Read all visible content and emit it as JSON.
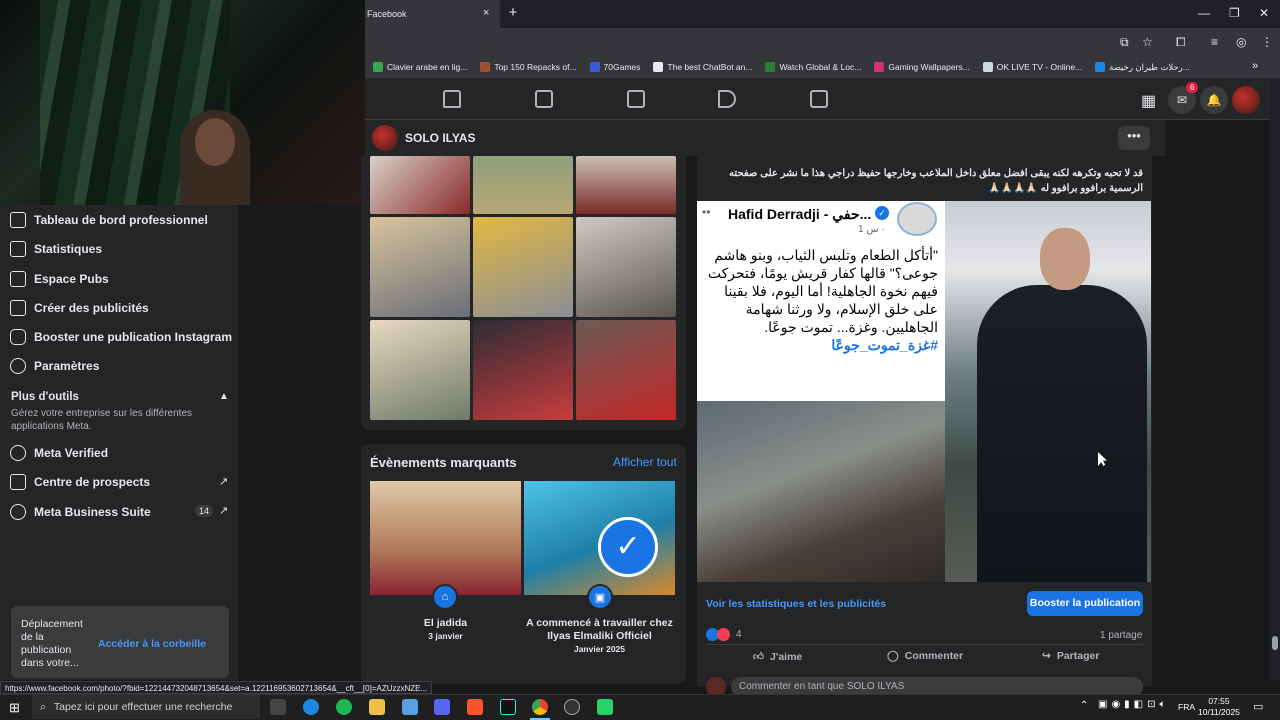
{
  "browser": {
    "tab_title": "Facebook",
    "tab_close": "×",
    "new_tab": "+",
    "window_min": "—",
    "window_max": "❐",
    "window_close": "✕",
    "bookmarks": [
      {
        "label": "Clavier arabe en lig...",
        "color": "#34a853"
      },
      {
        "label": "Top 150 Repacks of...",
        "color": "#a0522d"
      },
      {
        "label": "70Games",
        "color": "#3b5bdb"
      },
      {
        "label": "The best ChatBot an...",
        "color": "#e8eaed"
      },
      {
        "label": "Watch Global & Loc...",
        "color": "#2e7d32"
      },
      {
        "label": "Gaming Wallpapers...",
        "color": "#d6336c"
      },
      {
        "label": "OK LIVE TV - Online...",
        "color": "#cfd8dc"
      },
      {
        "label": "رحلات طيران رخيصة...",
        "color": "#1e88e5"
      }
    ],
    "bookmarks_more": "»",
    "status_url": "https://www.facebook.com/photo/?fbid=122144732048713654&set=a.122116953602713654&__cft__[0]=AZUzzxNZE..."
  },
  "fb_nav": {
    "messenger_badge": "6"
  },
  "page_header": {
    "name": "SOLO ILYAS",
    "more": "•••"
  },
  "sidebar": {
    "items": [
      {
        "label": "Tableau de bord professionnel",
        "icon": "dashboard-icon"
      },
      {
        "label": "Statistiques",
        "icon": "chart-icon"
      },
      {
        "label": "Espace Pubs",
        "icon": "megaphone-icon"
      },
      {
        "label": "Créer des publicités",
        "icon": "edit-icon"
      },
      {
        "label": "Booster une publication Instagram",
        "icon": "instagram-icon"
      },
      {
        "label": "Paramètres",
        "icon": "gear-icon"
      }
    ],
    "more_tools_title": "Plus d'outils",
    "more_tools_desc": "Gérez votre entreprise sur les différentes applications Meta.",
    "tools": [
      {
        "label": "Meta Verified",
        "icon": "verified-icon"
      },
      {
        "label": "Centre de prospects",
        "icon": "leads-icon"
      },
      {
        "label": "Meta Business Suite",
        "icon": "business-suite-icon"
      }
    ],
    "business_suite_badge": "14"
  },
  "toast": {
    "text": "Déplacement de la publication dans votre...",
    "link": "Accéder à la corbeille"
  },
  "highlights": {
    "title": "Évènements marquants",
    "see_all": "Afficher tout",
    "cards": [
      {
        "name": "El jadida",
        "date": "3 janvier"
      },
      {
        "name": "A commencé à travailler chez Ilyas Elmaliki Officiel",
        "date": "Janvier 2025"
      }
    ]
  },
  "post": {
    "text": "قد لا تحبه وتكرهه لكنه يبقى افضل معلق داخل الملاعب وخارجها حفيظ دراجي هذا ما نشر على صفحته الرسمية برافوو برافوو له 🙏🏻🙏🏻🙏🏻🙏🏻",
    "embedded": {
      "author": "Hafid Derradji - حفي...",
      "time": "1 س ·",
      "quote": "\"أتأكل الطعام وتلبس الثياب، وبنو هاشم جوعى؟\" قالها كفار قريش يومًا، فتحركت فيهم نخوة الجاهلية! أما اليوم، فلا بقينا على خلق الإسلام، ولا ورثنا شهامة الجاهليين. وغزة... تموت جوعًا.",
      "hashtag": "#غزة_تموت_جوعًا"
    },
    "stats_link": "Voir les statistiques et les publicités",
    "boost_button": "Booster la publication",
    "reactions_count": "4",
    "shares": "1 partage",
    "like": "J'aime",
    "comment": "Commenter",
    "share": "Partager",
    "comment_placeholder": "Commenter en tant que SOLO ILYAS"
  },
  "taskbar": {
    "search_placeholder": "Tapez ici pour effectuer une recherche",
    "lang": "FRA",
    "time": "07:55",
    "date": "10/11/2025"
  }
}
